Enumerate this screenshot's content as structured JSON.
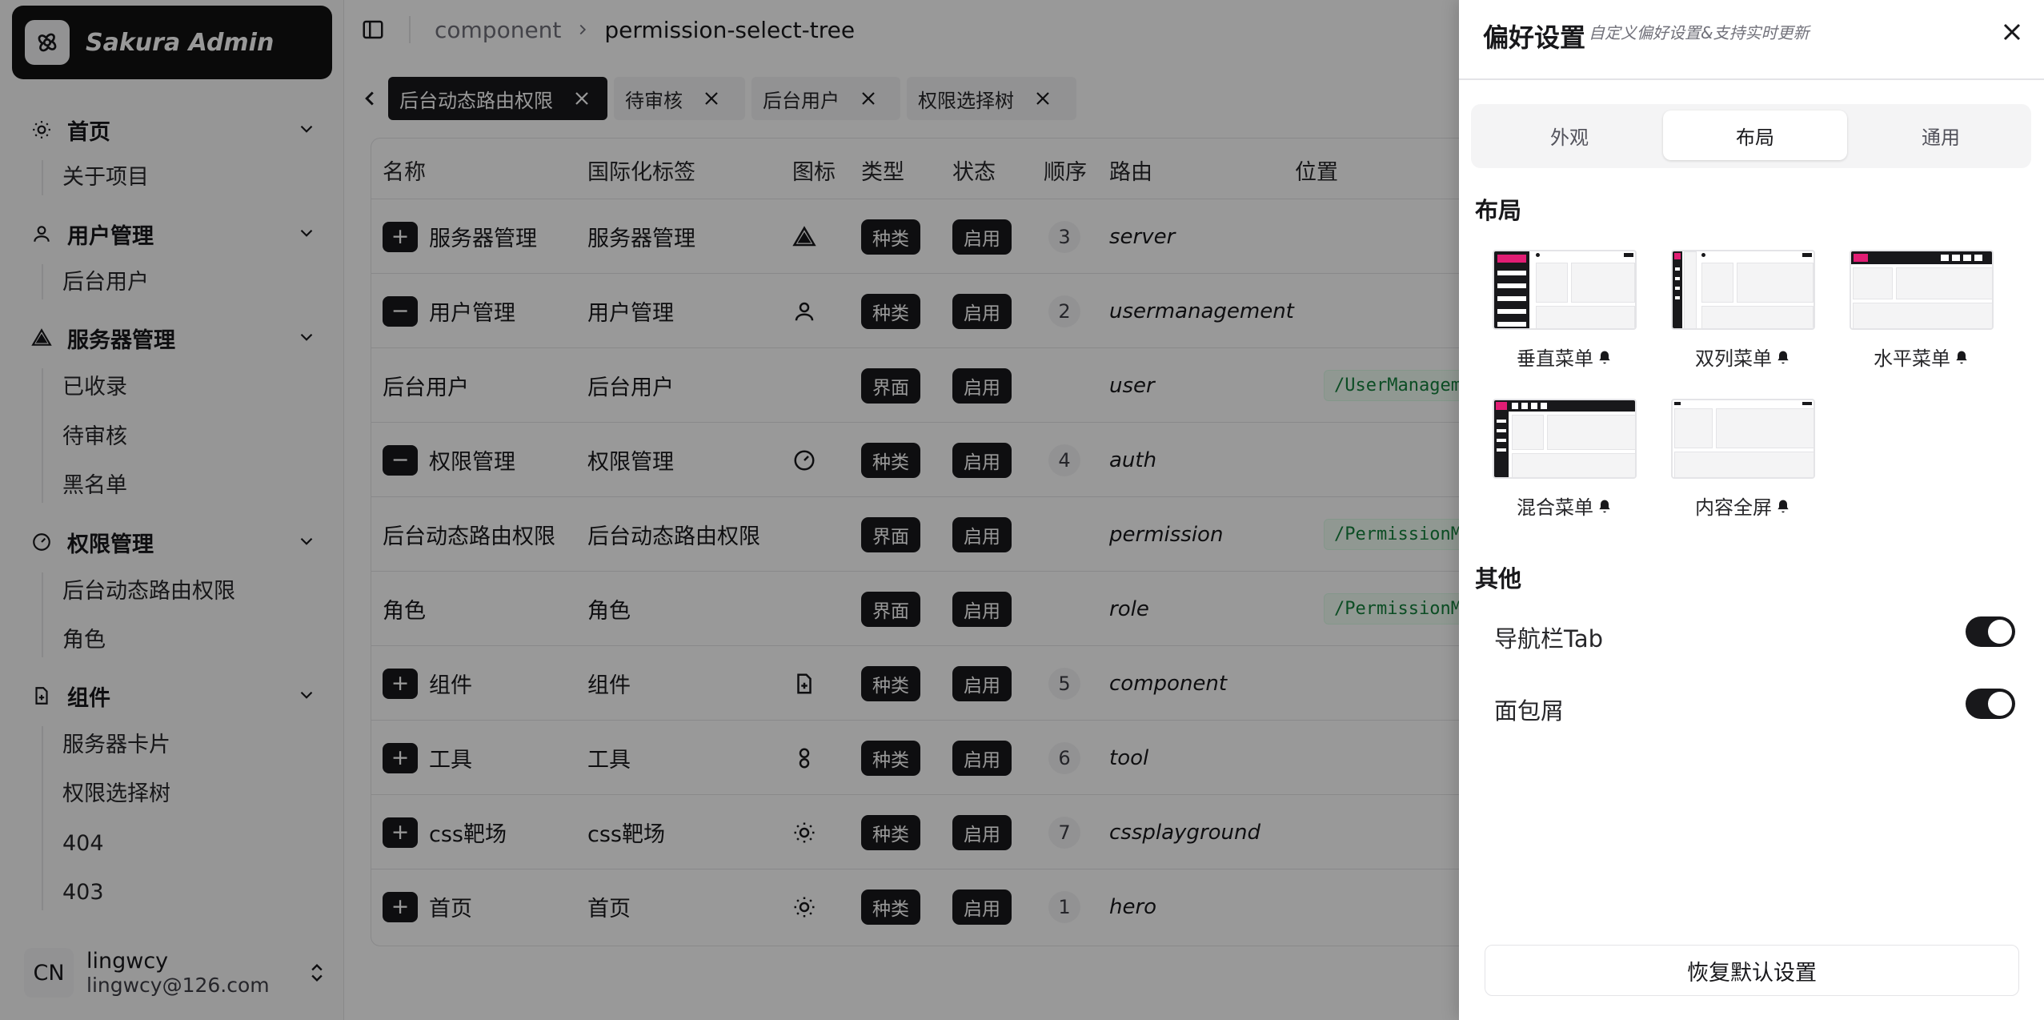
{
  "app": {
    "name": "Sakura Admin"
  },
  "sidebar": {
    "groups": [
      {
        "label": "首页",
        "icon": "sun-icon",
        "items": [
          {
            "label": "关于项目"
          }
        ]
      },
      {
        "label": "用户管理",
        "icon": "user-icon",
        "items": [
          {
            "label": "后台用户"
          }
        ]
      },
      {
        "label": "服务器管理",
        "icon": "triangle-icon",
        "items": [
          {
            "label": "已收录"
          },
          {
            "label": "待审核"
          },
          {
            "label": "黑名单"
          }
        ]
      },
      {
        "label": "权限管理",
        "icon": "gauge-icon",
        "items": [
          {
            "label": "后台动态路由权限"
          },
          {
            "label": "角色"
          }
        ]
      },
      {
        "label": "组件",
        "icon": "file-plus-icon",
        "items": [
          {
            "label": "服务器卡片"
          },
          {
            "label": "权限选择树"
          },
          {
            "label": "404"
          },
          {
            "label": "403"
          }
        ]
      }
    ],
    "user": {
      "avatar": "CN",
      "name": "lingwcy",
      "email": "lingwcy@126.com"
    }
  },
  "breadcrumb": [
    "component",
    "permission-select-tree"
  ],
  "tabs": [
    {
      "label": "后台动态路由权限",
      "active": true
    },
    {
      "label": "待审核",
      "active": false
    },
    {
      "label": "后台用户",
      "active": false
    },
    {
      "label": "权限选择树",
      "active": false
    }
  ],
  "table": {
    "columns": [
      "名称",
      "国际化标签",
      "图标",
      "类型",
      "状态",
      "顺序",
      "路由",
      "位置"
    ],
    "rows": [
      {
        "expander": "+",
        "name": "服务器管理",
        "i18n": "服务器管理",
        "icon": "triangle-icon",
        "type": "种类",
        "status": "启用",
        "order": "3",
        "route": "server",
        "location": ""
      },
      {
        "expander": "−",
        "name": "用户管理",
        "i18n": "用户管理",
        "icon": "user-icon",
        "type": "种类",
        "status": "启用",
        "order": "2",
        "route": "usermanagement",
        "location": ""
      },
      {
        "expander": "",
        "name": "后台用户",
        "i18n": "后台用户",
        "icon": "",
        "type": "界面",
        "status": "启用",
        "order": "",
        "route": "user",
        "location": "/UserManagement"
      },
      {
        "expander": "−",
        "name": "权限管理",
        "i18n": "权限管理",
        "icon": "gauge-icon",
        "type": "种类",
        "status": "启用",
        "order": "4",
        "route": "auth",
        "location": ""
      },
      {
        "expander": "",
        "name": "后台动态路由权限",
        "i18n": "后台动态路由权限",
        "icon": "",
        "type": "界面",
        "status": "启用",
        "order": "",
        "route": "permission",
        "location": "/PermissionMana"
      },
      {
        "expander": "",
        "name": "角色",
        "i18n": "角色",
        "icon": "",
        "type": "界面",
        "status": "启用",
        "order": "",
        "route": "role",
        "location": "/PermissionMana"
      },
      {
        "expander": "+",
        "name": "组件",
        "i18n": "组件",
        "icon": "file-plus-icon",
        "type": "种类",
        "status": "启用",
        "order": "5",
        "route": "component",
        "location": ""
      },
      {
        "expander": "+",
        "name": "工具",
        "i18n": "工具",
        "icon": "link-icon",
        "type": "种类",
        "status": "启用",
        "order": "6",
        "route": "tool",
        "location": ""
      },
      {
        "expander": "+",
        "name": "css靶场",
        "i18n": "css靶场",
        "icon": "sun-icon",
        "type": "种类",
        "status": "启用",
        "order": "7",
        "route": "cssplayground",
        "location": ""
      },
      {
        "expander": "+",
        "name": "首页",
        "i18n": "首页",
        "icon": "sun-icon",
        "type": "种类",
        "status": "启用",
        "order": "1",
        "route": "hero",
        "location": ""
      }
    ]
  },
  "drawer": {
    "title": "偏好设置",
    "subtitle": "自定义偏好设置&支持实时更新",
    "tabs": [
      {
        "label": "外观"
      },
      {
        "label": "布局"
      },
      {
        "label": "通用"
      }
    ],
    "active_tab": "布局",
    "layout_section": "布局",
    "layouts": [
      {
        "label": "垂直菜单"
      },
      {
        "label": "双列菜单"
      },
      {
        "label": "水平菜单"
      },
      {
        "label": "混合菜单"
      },
      {
        "label": "内容全屏"
      }
    ],
    "other_section": "其他",
    "options": [
      {
        "label": "导航栏Tab",
        "on": true
      },
      {
        "label": "面包屑",
        "on": true
      }
    ],
    "reset_label": "恢复默认设置"
  },
  "colors": {
    "accent": "#18181b",
    "brand_pink": "#e11d74",
    "overlay": "rgba(0,0,0,0.4)"
  }
}
